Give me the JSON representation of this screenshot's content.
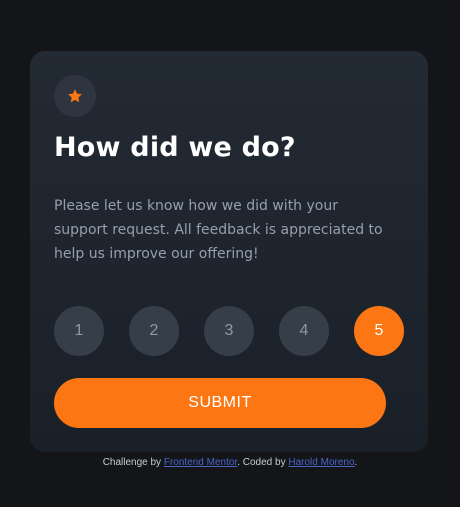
{
  "card": {
    "title": "How did we do?",
    "description": "Please let us know how we did with your support request. All feedback is appreciated to help us improve our offering!",
    "icon": "star-icon"
  },
  "rating": {
    "options": [
      "1",
      "2",
      "3",
      "4",
      "5"
    ],
    "selected": "5"
  },
  "submit_label": "SUBMIT",
  "attribution": {
    "prefix": "Challenge by ",
    "link1": "Frontend Mentor",
    "middle": ". Coded by ",
    "link2": "Harold Moreno",
    "suffix": "."
  },
  "colors": {
    "accent": "#fc7614",
    "background": "#131518",
    "card": "#232a34",
    "rating_button": "#363e4a",
    "link": "#4b64c8"
  }
}
